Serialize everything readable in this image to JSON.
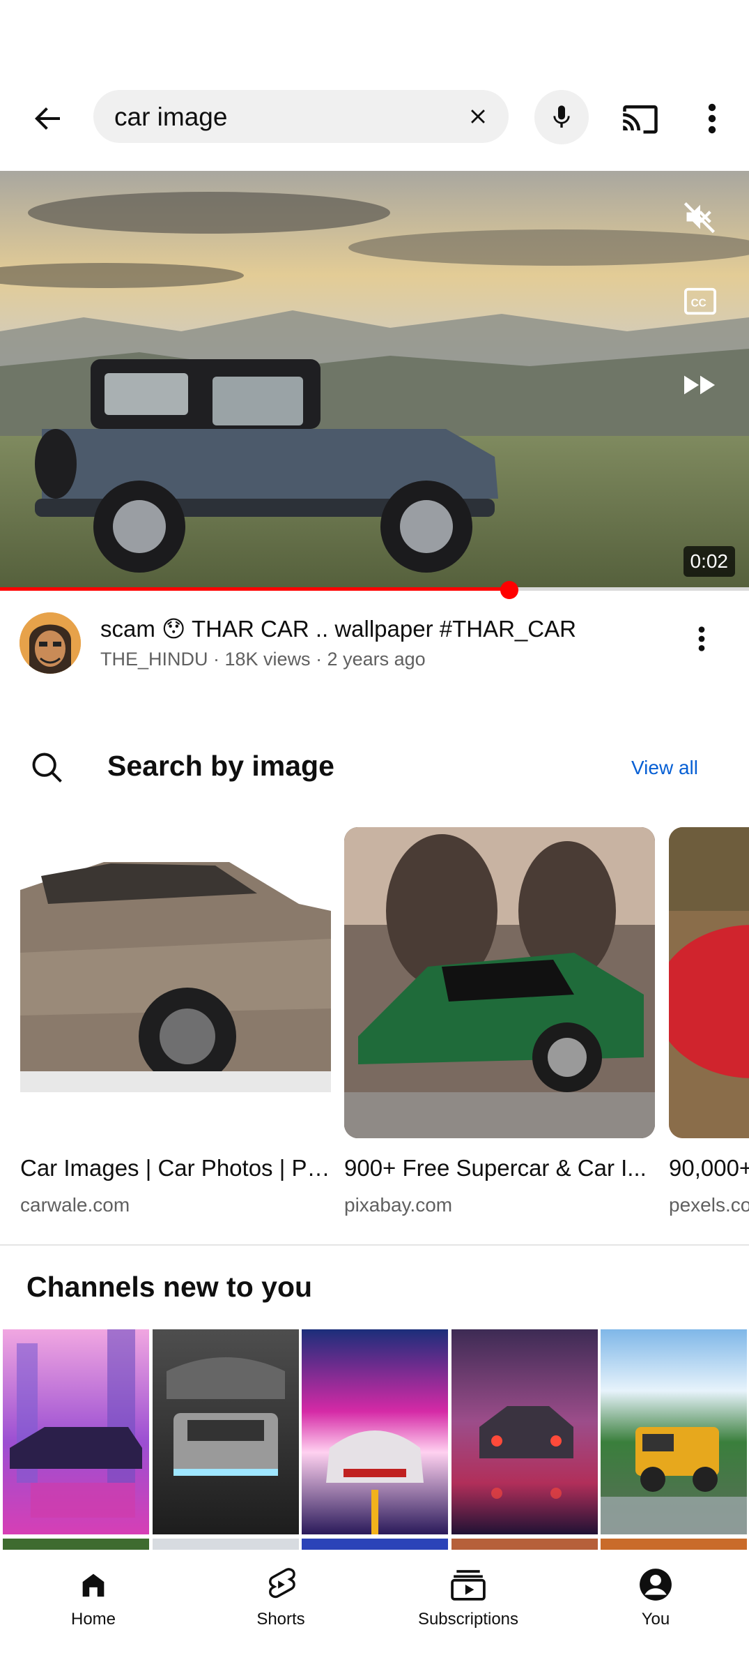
{
  "search": {
    "query": "car image"
  },
  "video": {
    "title": "scam 😯 THAR CAR .. wallpaper  #THAR_CAR",
    "channel_line": "THE_HINDU · 18K views · 2 years ago",
    "duration": "0:02",
    "progress": 0.68
  },
  "search_by_image": {
    "title": "Search by image",
    "view_all": "View all",
    "cards": [
      {
        "title": "Car Images | Car Photos | Pi...",
        "source": "carwale.com"
      },
      {
        "title": "900+ Free Supercar & Car I...",
        "source": "pixabay.com"
      },
      {
        "title": "90,000+",
        "source": "pexels.co"
      }
    ]
  },
  "channels": {
    "title": "Channels new to you"
  },
  "bottom_nav": {
    "items": [
      {
        "label": "Home",
        "icon": "home-icon"
      },
      {
        "label": "Shorts",
        "icon": "shorts-icon"
      },
      {
        "label": "Subscriptions",
        "icon": "subscriptions-icon"
      },
      {
        "label": "You",
        "icon": "account-icon"
      }
    ]
  },
  "colors": {
    "accent_red": "#ff0000",
    "link_blue": "#065fd4",
    "secondary_text": "#606060"
  }
}
